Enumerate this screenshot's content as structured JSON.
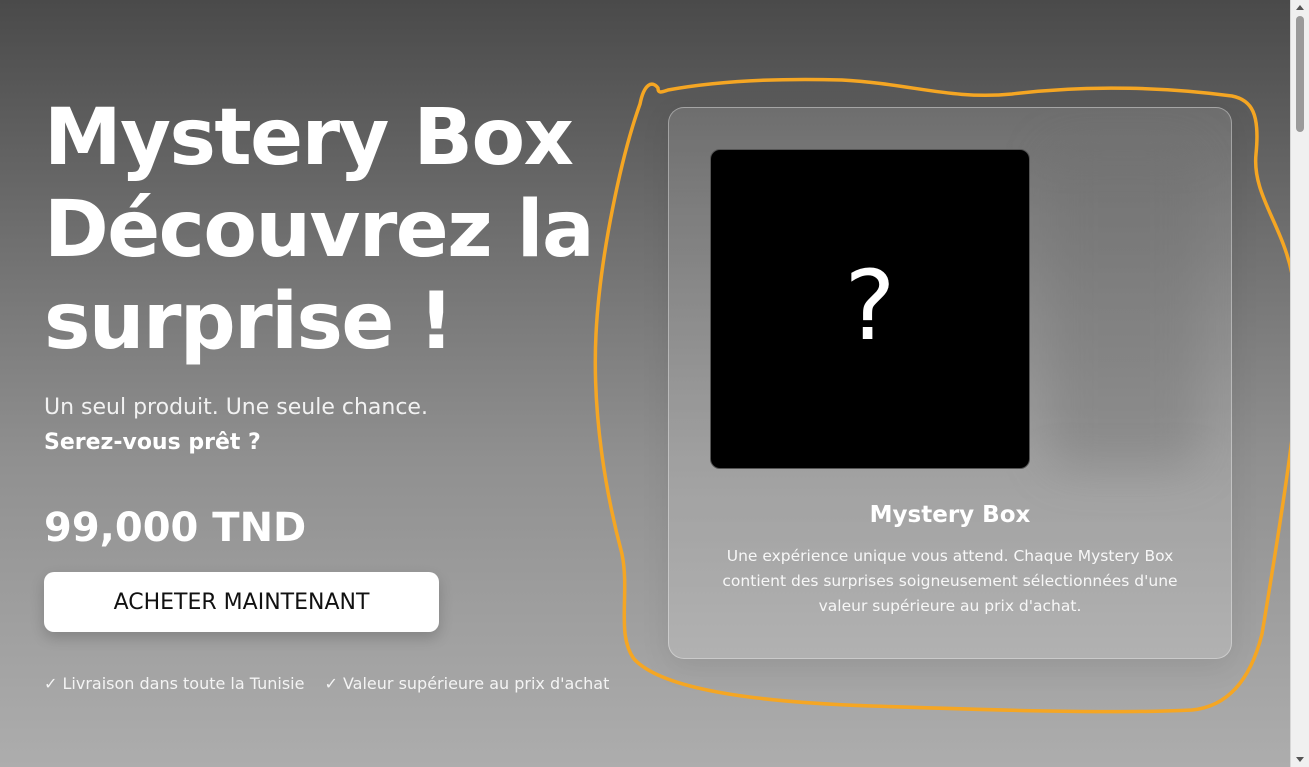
{
  "hero": {
    "title_lines": [
      "Mystery Box",
      "Découvrez la",
      "surprise !"
    ],
    "subtitle": "Un seul produit. Une seule chance.",
    "tagline": "Serez-vous prêt ?",
    "price": "99,000 TND",
    "buy_label": "ACHETER MAINTENANT",
    "features": [
      "✓ Livraison dans toute la Tunisie",
      "✓ Valeur supérieure au prix d'achat"
    ]
  },
  "product_card": {
    "image_symbol": "?",
    "title": "Mystery Box",
    "description": "Une expérience unique vous attend. Chaque Mystery Box contient des surprises soigneusement sélectionnées d'une valeur supérieure au prix d'achat."
  },
  "colors": {
    "highlight_stroke": "#f5a623",
    "button_bg": "#ffffff",
    "image_bg": "#000000"
  }
}
